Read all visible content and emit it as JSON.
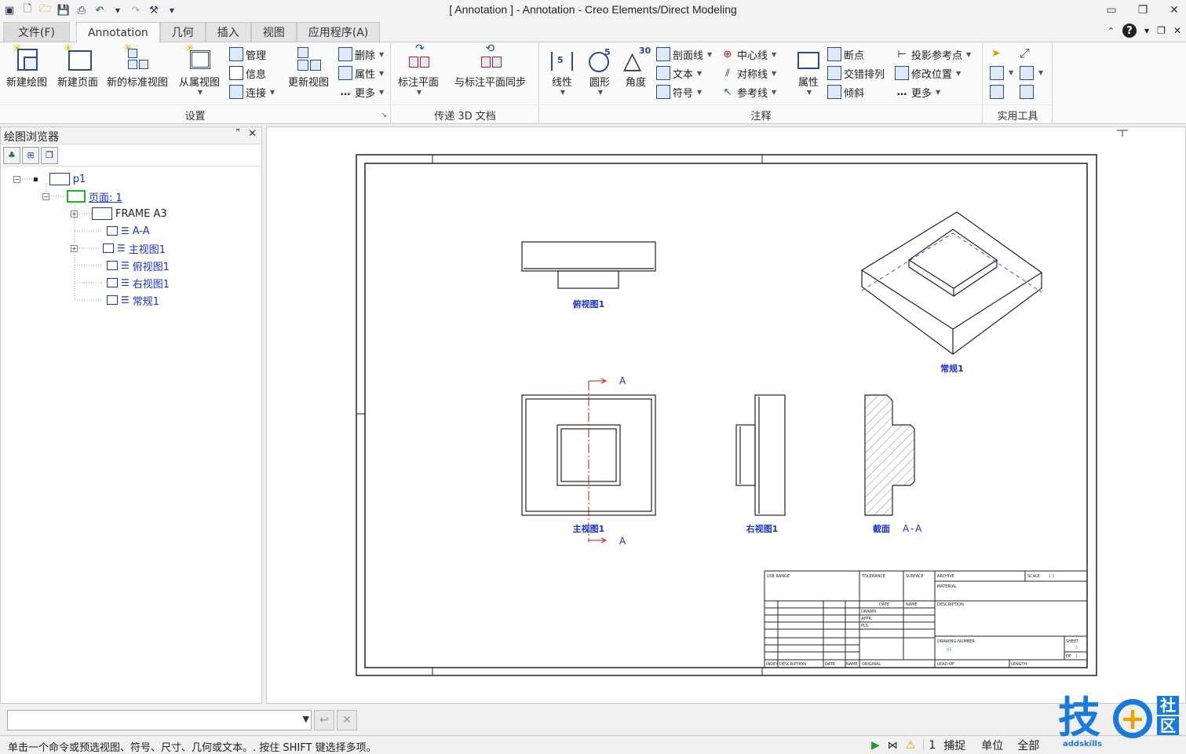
{
  "window": {
    "title": "[ Annotation ] - Annotation - Creo Elements/Direct Modeling",
    "min_glyph": "▭",
    "restore_glyph": "❐",
    "close_glyph": "✕"
  },
  "tabs": [
    {
      "label": "文件(F)"
    },
    {
      "label": "Annotation"
    },
    {
      "label": "几何"
    },
    {
      "label": "插入"
    },
    {
      "label": "视图"
    },
    {
      "label": "应用程序(A)"
    }
  ],
  "help_label": "?",
  "ribbon": {
    "setup": {
      "group_label": "设置",
      "new_drawing": "新建绘图",
      "new_page": "新建页面",
      "new_std_view": "新的标准视图",
      "from_subview": "从属视图",
      "manage": "管理",
      "info": "信息",
      "connect": "连接",
      "update_view": "更新视图",
      "delete": "删除",
      "properties": "属性",
      "more": "更多"
    },
    "transfer": {
      "group_label": "传递 3D 文档",
      "annotation_plane": "标注平面",
      "sync_plane": "与标注平面同步"
    },
    "annotate": {
      "group_label": "注释",
      "linear": "线性",
      "circular": "圆形",
      "angle": "角度",
      "linear_num": "5",
      "circle_num": "5",
      "angle_num": "30",
      "hatch": "剖面线",
      "text": "文本",
      "symbol": "符号",
      "centerline": "中心线",
      "symmetry": "对称线",
      "reference_line": "参考线",
      "props": "属性",
      "break": "断点",
      "stagger": "交错排列",
      "skew": "倾斜",
      "proj_ref": "投影参考点",
      "modify_pos": "修改位置",
      "more": "更多"
    },
    "utilities": {
      "group_label": "实用工具"
    }
  },
  "browser": {
    "title": "绘图浏览器",
    "pin_glyph": "📌",
    "close_glyph": "✕",
    "tree": [
      {
        "label": "p1"
      },
      {
        "label": "页面: 1"
      },
      {
        "label": "FRAME A3"
      },
      {
        "label": "A-A"
      },
      {
        "label": "主视图1"
      },
      {
        "label": "俯视图1"
      },
      {
        "label": "右视图1"
      },
      {
        "label": "常规1"
      }
    ]
  },
  "drawing": {
    "view_labels": {
      "top": "俯视图1",
      "iso": "常规1",
      "front": "主视图1",
      "right": "右视图1",
      "section_prefix": "截面",
      "section_name": "A-A",
      "cut_letter_top": "A",
      "cut_letter_bottom": "A"
    },
    "title_block": {
      "use_range": "USE RANGE",
      "tolerance": "TOLERANCE",
      "surface": "SURFACE",
      "archive": "ARCHIVE",
      "scale": "SCALE",
      "scale_val": "1:1",
      "material": "MATERIAL",
      "date": "DATE",
      "name": "NAME",
      "description": "DESCRIPTION",
      "drawn": "DRAWN",
      "appr": "APPR.",
      "pls": "PLS.",
      "drawing_number": "DRAWING-NUMBER",
      "drawing_number_val": "p1",
      "sheet": "SHEET",
      "sheet_val": "1",
      "of": "OF",
      "of_val": "1",
      "index": "INDEX",
      "descr2": "DESCRIPTION",
      "date2": "DATE",
      "name2": "NAME",
      "original": "ORIGINAL",
      "lead": "LEAD-OF",
      "length": "LENGTH"
    }
  },
  "command": {
    "value": "",
    "enter_glyph": "↩",
    "cancel_glyph": "✕"
  },
  "status": {
    "message": "单击一个命令或预选视图、符号、尺寸、几何或文本。. 按住 SHIFT 键选择多项。",
    "page_num": "1",
    "snap": "捕捉",
    "units": "单位",
    "all": "全部"
  },
  "logo": {
    "char1": "技",
    "char2": "社",
    "char3": "区",
    "site": "addskills"
  }
}
